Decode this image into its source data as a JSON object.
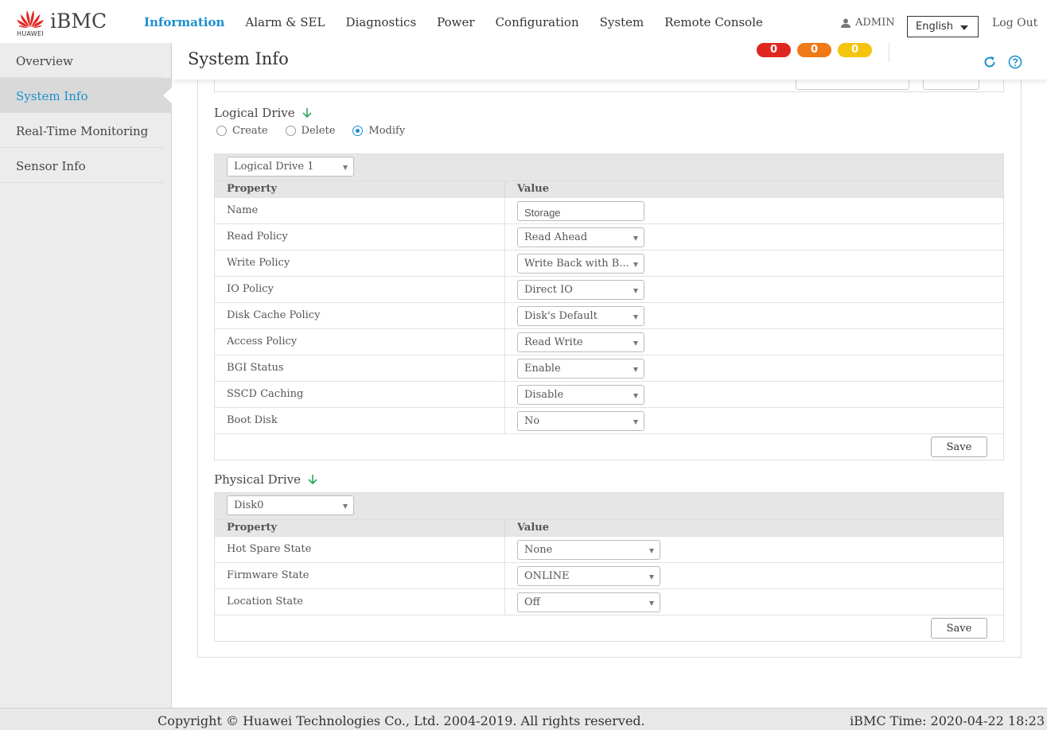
{
  "app": {
    "brand_small": "HUAWEI",
    "brand": "iBMC",
    "brand_color": "#e0271f",
    "accent_color": "#1a8fcf"
  },
  "nav": {
    "items": [
      "Information",
      "Alarm & SEL",
      "Diagnostics",
      "Power",
      "Configuration",
      "System",
      "Remote Console"
    ],
    "active": "Information"
  },
  "user": {
    "name": "ADMIN",
    "icon": "user-icon"
  },
  "language": {
    "selected": "English"
  },
  "logout_label": "Log Out",
  "sidebar": {
    "items": [
      "Overview",
      "System Info",
      "Real-Time Monitoring",
      "Sensor Info"
    ],
    "active": "System Info"
  },
  "header": {
    "title": "System Info",
    "alarm_counts": {
      "critical": "0",
      "major": "0",
      "minor": "0"
    },
    "refresh_icon": "refresh-icon",
    "help_icon": "help-icon"
  },
  "logical_drive": {
    "title": "Logical Drive",
    "expand_icon": "arrow-down-icon",
    "modes": [
      "Create",
      "Delete",
      "Modify"
    ],
    "selected_mode": "Modify",
    "drive_select": "Logical Drive 1",
    "col_property": "Property",
    "col_value": "Value",
    "rows": [
      {
        "property": "Name",
        "value": "Storage"
      },
      {
        "property": "Read Policy",
        "value": "Read Ahead"
      },
      {
        "property": "Write Policy",
        "value": "Write Back with B..."
      },
      {
        "property": "IO Policy",
        "value": "Direct IO"
      },
      {
        "property": "Disk Cache Policy",
        "value": "Disk's Default"
      },
      {
        "property": "Access Policy",
        "value": "Read Write"
      },
      {
        "property": "BGI Status",
        "value": "Enable"
      },
      {
        "property": "SSCD Caching",
        "value": "Disable"
      },
      {
        "property": "Boot Disk",
        "value": "No"
      }
    ],
    "save_label": "Save"
  },
  "physical_drive": {
    "title": "Physical Drive",
    "expand_icon": "arrow-down-icon",
    "drive_select": "Disk0",
    "col_property": "Property",
    "col_value": "Value",
    "rows": [
      {
        "property": "Hot Spare State",
        "value": "None"
      },
      {
        "property": "Firmware State",
        "value": "ONLINE"
      },
      {
        "property": "Location State",
        "value": "Off"
      }
    ],
    "save_label": "Save"
  },
  "footer": {
    "copyright": "Copyright © Huawei Technologies Co., Ltd. 2004-2019. All rights reserved.",
    "bmc_time": "iBMC Time: 2020-04-22 18:23"
  }
}
